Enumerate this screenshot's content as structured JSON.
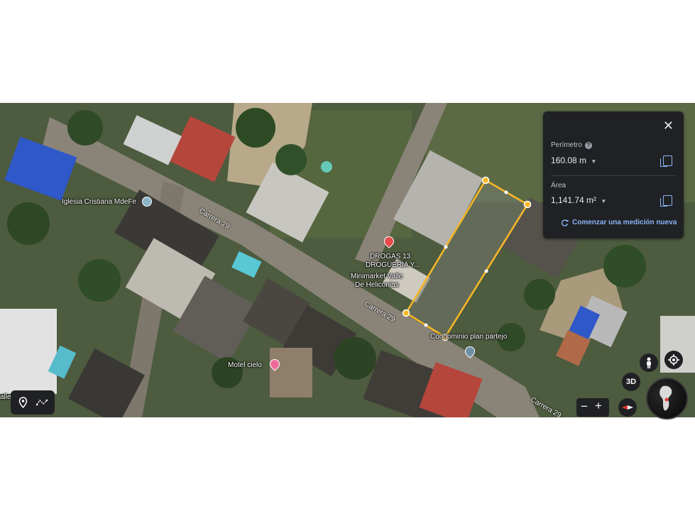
{
  "measurement": {
    "perimeter_label": "Perímetro",
    "perimeter_value": "160.08 m",
    "area_label": "Área",
    "area_value": "1,141.74 m²",
    "new_measurement": "Comenzar una medición nueva",
    "close_icon": "close-icon",
    "help_icon": "help-icon",
    "copy_icon": "copy-icon"
  },
  "map_labels": {
    "iglesia": "Iglesia Cristiana MdeFe",
    "carrera29_a": "Carrera 29",
    "carrera29_b": "Carrera 29",
    "carrera29_c": "Carrera 29",
    "drogas1": "DROGAS 13",
    "drogas2": "DROGUERIA Y...",
    "minimarket1": "Minimarket Valle",
    "minimarket2": "De Heliconias",
    "condominio": "Condominio plan partejo",
    "motel": "Motel cielo",
    "left_edge": "alle"
  },
  "controls": {
    "view_3d": "3D",
    "zoom_out": "−",
    "zoom_in": "+",
    "pegman_icon": "pegman-icon",
    "locate_icon": "my-location-icon",
    "compass_icon": "compass-icon",
    "globe_icon": "globe-icon",
    "place_icon": "place-icon",
    "measure_icon": "measure-path-icon"
  },
  "colors": {
    "polygon_stroke": "#f9b826",
    "panel_bg": "#202124",
    "accent": "#8ab4f8"
  }
}
